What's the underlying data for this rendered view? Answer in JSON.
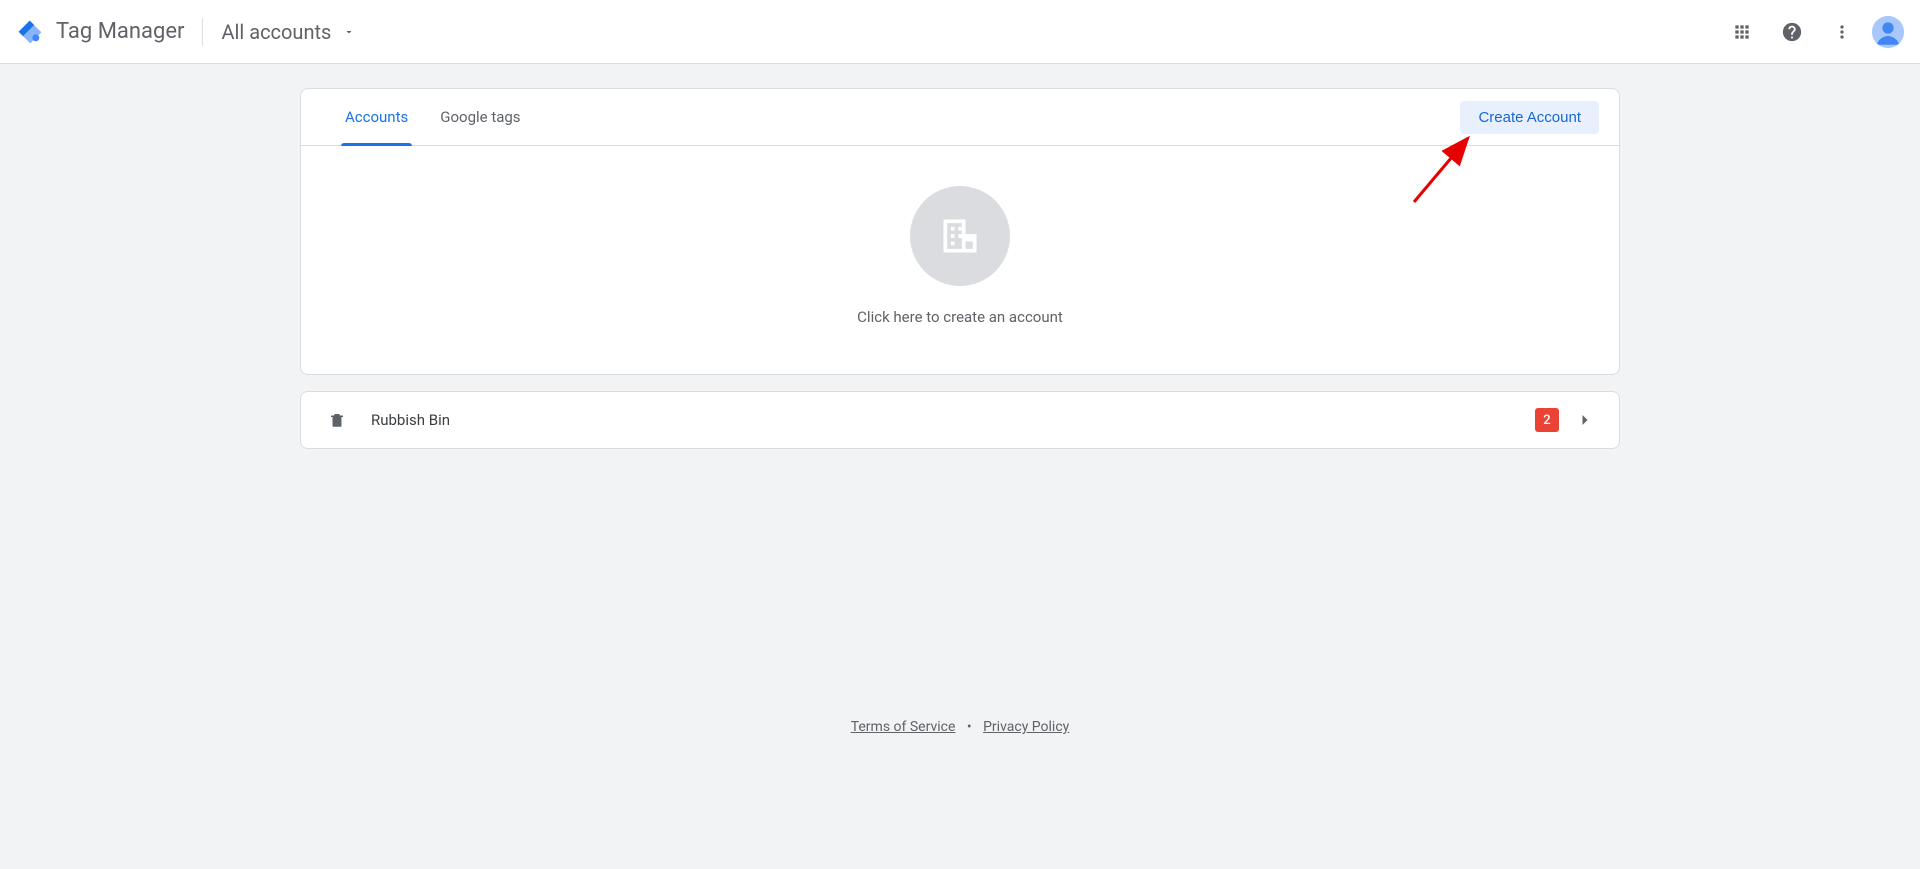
{
  "header": {
    "product_title": "Tag Manager",
    "breadcrumb_label": "All accounts"
  },
  "tabs": {
    "accounts_label": "Accounts",
    "google_tags_label": "Google tags",
    "active": "accounts"
  },
  "actions": {
    "create_account_label": "Create Account"
  },
  "empty_state": {
    "text": "Click here to create an account"
  },
  "rubbish_bin": {
    "label": "Rubbish Bin",
    "badge_count": "2"
  },
  "footer": {
    "terms_label": "Terms of Service",
    "privacy_label": "Privacy Policy"
  }
}
